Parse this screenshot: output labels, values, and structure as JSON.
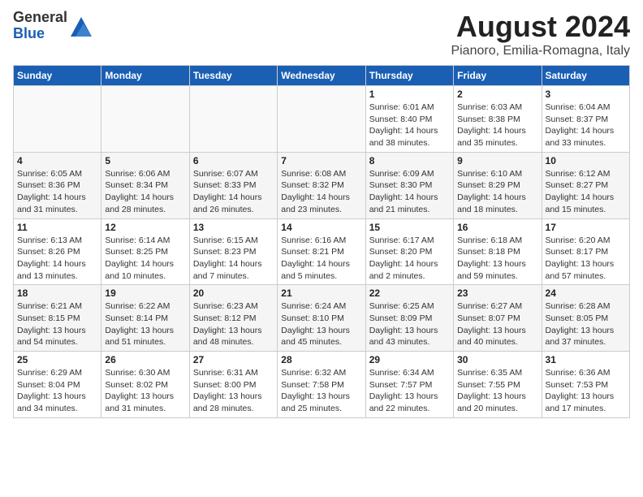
{
  "logo": {
    "general": "General",
    "blue": "Blue"
  },
  "title": "August 2024",
  "subtitle": "Pianoro, Emilia-Romagna, Italy",
  "days_of_week": [
    "Sunday",
    "Monday",
    "Tuesday",
    "Wednesday",
    "Thursday",
    "Friday",
    "Saturday"
  ],
  "weeks": [
    [
      {
        "day": "",
        "info": ""
      },
      {
        "day": "",
        "info": ""
      },
      {
        "day": "",
        "info": ""
      },
      {
        "day": "",
        "info": ""
      },
      {
        "day": "1",
        "info": "Sunrise: 6:01 AM\nSunset: 8:40 PM\nDaylight: 14 hours\nand 38 minutes."
      },
      {
        "day": "2",
        "info": "Sunrise: 6:03 AM\nSunset: 8:38 PM\nDaylight: 14 hours\nand 35 minutes."
      },
      {
        "day": "3",
        "info": "Sunrise: 6:04 AM\nSunset: 8:37 PM\nDaylight: 14 hours\nand 33 minutes."
      }
    ],
    [
      {
        "day": "4",
        "info": "Sunrise: 6:05 AM\nSunset: 8:36 PM\nDaylight: 14 hours\nand 31 minutes."
      },
      {
        "day": "5",
        "info": "Sunrise: 6:06 AM\nSunset: 8:34 PM\nDaylight: 14 hours\nand 28 minutes."
      },
      {
        "day": "6",
        "info": "Sunrise: 6:07 AM\nSunset: 8:33 PM\nDaylight: 14 hours\nand 26 minutes."
      },
      {
        "day": "7",
        "info": "Sunrise: 6:08 AM\nSunset: 8:32 PM\nDaylight: 14 hours\nand 23 minutes."
      },
      {
        "day": "8",
        "info": "Sunrise: 6:09 AM\nSunset: 8:30 PM\nDaylight: 14 hours\nand 21 minutes."
      },
      {
        "day": "9",
        "info": "Sunrise: 6:10 AM\nSunset: 8:29 PM\nDaylight: 14 hours\nand 18 minutes."
      },
      {
        "day": "10",
        "info": "Sunrise: 6:12 AM\nSunset: 8:27 PM\nDaylight: 14 hours\nand 15 minutes."
      }
    ],
    [
      {
        "day": "11",
        "info": "Sunrise: 6:13 AM\nSunset: 8:26 PM\nDaylight: 14 hours\nand 13 minutes."
      },
      {
        "day": "12",
        "info": "Sunrise: 6:14 AM\nSunset: 8:25 PM\nDaylight: 14 hours\nand 10 minutes."
      },
      {
        "day": "13",
        "info": "Sunrise: 6:15 AM\nSunset: 8:23 PM\nDaylight: 14 hours\nand 7 minutes."
      },
      {
        "day": "14",
        "info": "Sunrise: 6:16 AM\nSunset: 8:21 PM\nDaylight: 14 hours\nand 5 minutes."
      },
      {
        "day": "15",
        "info": "Sunrise: 6:17 AM\nSunset: 8:20 PM\nDaylight: 14 hours\nand 2 minutes."
      },
      {
        "day": "16",
        "info": "Sunrise: 6:18 AM\nSunset: 8:18 PM\nDaylight: 13 hours\nand 59 minutes."
      },
      {
        "day": "17",
        "info": "Sunrise: 6:20 AM\nSunset: 8:17 PM\nDaylight: 13 hours\nand 57 minutes."
      }
    ],
    [
      {
        "day": "18",
        "info": "Sunrise: 6:21 AM\nSunset: 8:15 PM\nDaylight: 13 hours\nand 54 minutes."
      },
      {
        "day": "19",
        "info": "Sunrise: 6:22 AM\nSunset: 8:14 PM\nDaylight: 13 hours\nand 51 minutes."
      },
      {
        "day": "20",
        "info": "Sunrise: 6:23 AM\nSunset: 8:12 PM\nDaylight: 13 hours\nand 48 minutes."
      },
      {
        "day": "21",
        "info": "Sunrise: 6:24 AM\nSunset: 8:10 PM\nDaylight: 13 hours\nand 45 minutes."
      },
      {
        "day": "22",
        "info": "Sunrise: 6:25 AM\nSunset: 8:09 PM\nDaylight: 13 hours\nand 43 minutes."
      },
      {
        "day": "23",
        "info": "Sunrise: 6:27 AM\nSunset: 8:07 PM\nDaylight: 13 hours\nand 40 minutes."
      },
      {
        "day": "24",
        "info": "Sunrise: 6:28 AM\nSunset: 8:05 PM\nDaylight: 13 hours\nand 37 minutes."
      }
    ],
    [
      {
        "day": "25",
        "info": "Sunrise: 6:29 AM\nSunset: 8:04 PM\nDaylight: 13 hours\nand 34 minutes."
      },
      {
        "day": "26",
        "info": "Sunrise: 6:30 AM\nSunset: 8:02 PM\nDaylight: 13 hours\nand 31 minutes."
      },
      {
        "day": "27",
        "info": "Sunrise: 6:31 AM\nSunset: 8:00 PM\nDaylight: 13 hours\nand 28 minutes."
      },
      {
        "day": "28",
        "info": "Sunrise: 6:32 AM\nSunset: 7:58 PM\nDaylight: 13 hours\nand 25 minutes."
      },
      {
        "day": "29",
        "info": "Sunrise: 6:34 AM\nSunset: 7:57 PM\nDaylight: 13 hours\nand 22 minutes."
      },
      {
        "day": "30",
        "info": "Sunrise: 6:35 AM\nSunset: 7:55 PM\nDaylight: 13 hours\nand 20 minutes."
      },
      {
        "day": "31",
        "info": "Sunrise: 6:36 AM\nSunset: 7:53 PM\nDaylight: 13 hours\nand 17 minutes."
      }
    ]
  ]
}
